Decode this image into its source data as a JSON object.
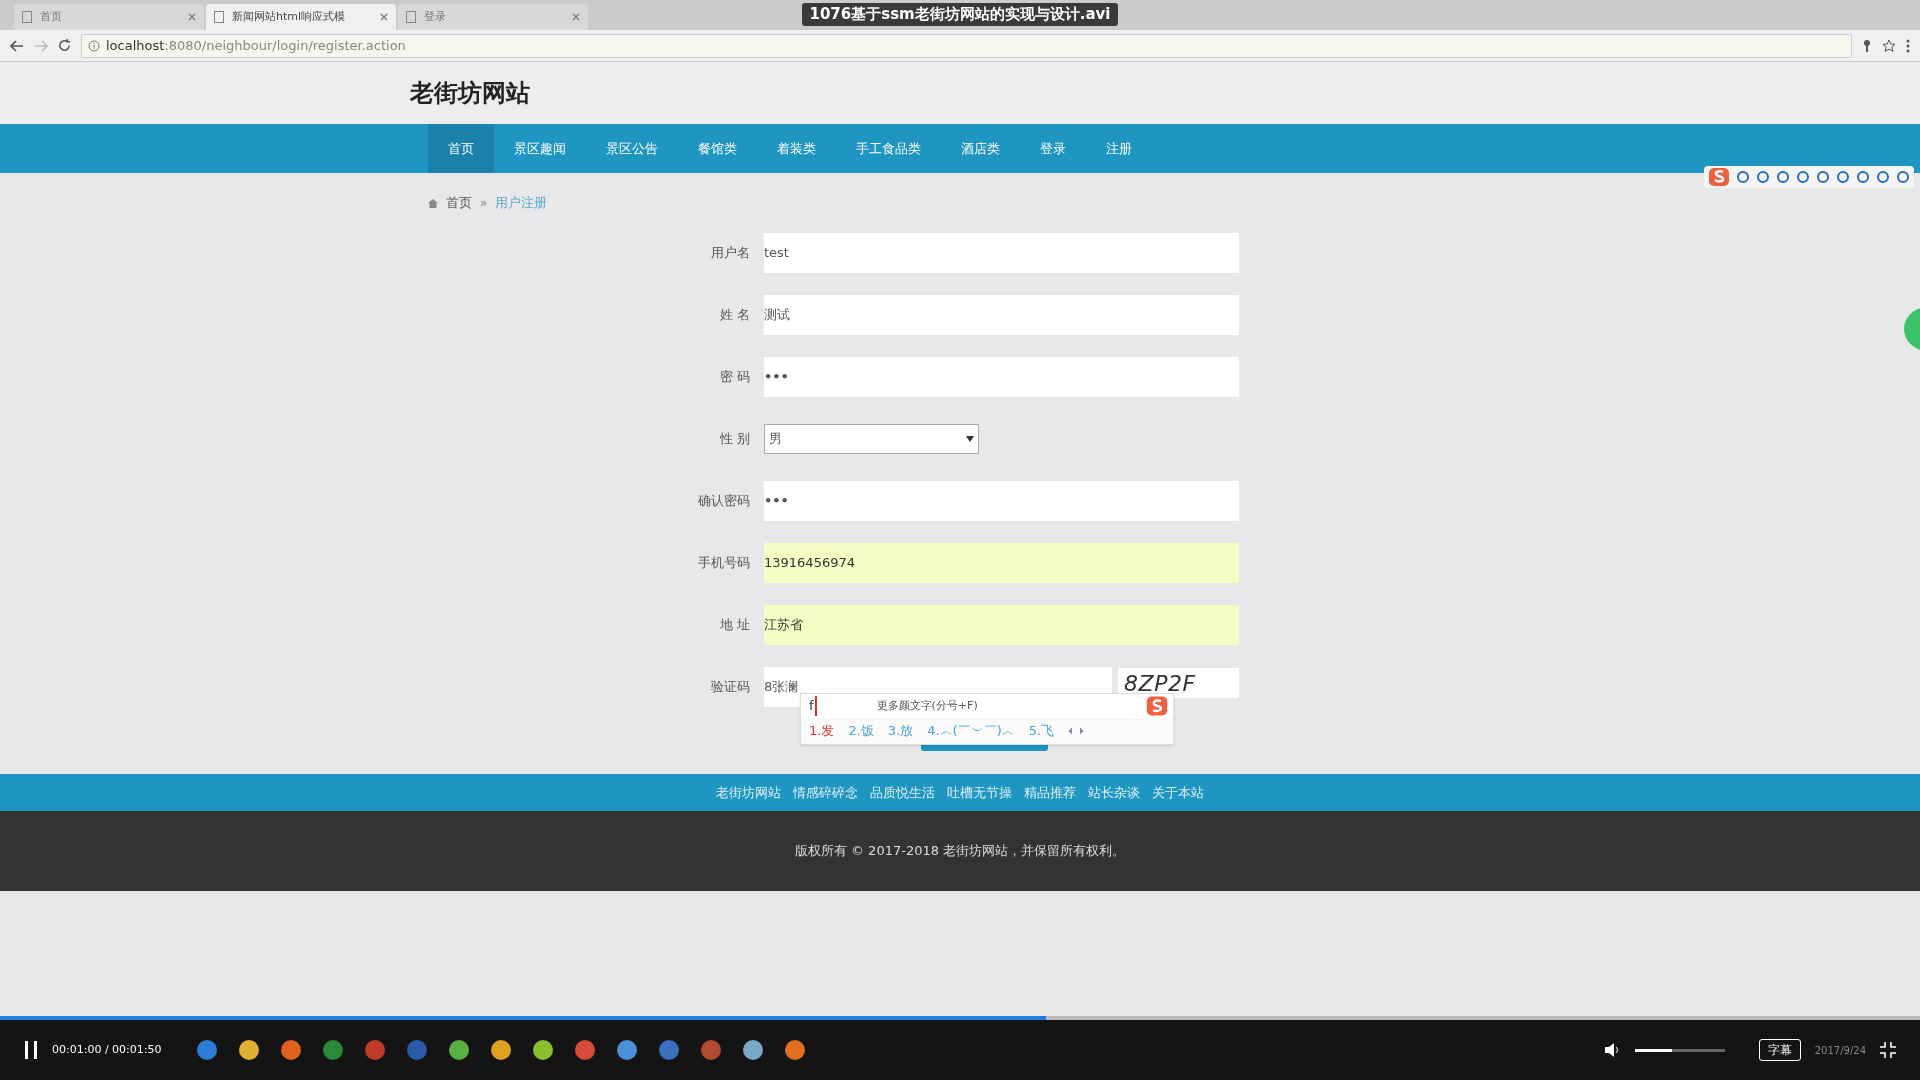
{
  "browser": {
    "tabs": [
      {
        "label": "首页",
        "selected": false
      },
      {
        "label": "新闻网站html响应式模",
        "selected": true
      },
      {
        "label": "登录",
        "selected": false
      }
    ],
    "url_host": "localhost",
    "url_path": ":8080/neighbour/login/register.action"
  },
  "video_title": "1076基于ssm老街坊网站的实现与设计.avi",
  "site": {
    "title": "老街坊网站",
    "nav": [
      {
        "label": "首页",
        "selected": true
      },
      {
        "label": "景区趣闻",
        "selected": false
      },
      {
        "label": "景区公告",
        "selected": false
      },
      {
        "label": "餐馆类",
        "selected": false
      },
      {
        "label": "着装类",
        "selected": false
      },
      {
        "label": "手工食品类",
        "selected": false
      },
      {
        "label": "酒店类",
        "selected": false
      },
      {
        "label": "登录",
        "selected": false
      },
      {
        "label": "注册",
        "selected": false
      }
    ],
    "breadcrumb": {
      "items": [
        "首页",
        "用户注册"
      ],
      "separator": "»"
    }
  },
  "form": {
    "fields": [
      {
        "label": "用户名",
        "kind": "text",
        "value": "test",
        "autofilled": false
      },
      {
        "label": "姓 名",
        "kind": "text",
        "value": "测试",
        "autofilled": false
      },
      {
        "label": "密 码",
        "kind": "password",
        "value": "•••",
        "autofilled": false
      },
      {
        "label": "性 别",
        "kind": "select",
        "value": "男",
        "autofilled": false
      },
      {
        "label": "确认密码",
        "kind": "password",
        "value": "•••",
        "autofilled": false
      },
      {
        "label": "手机号码",
        "kind": "text",
        "value": "13916456974",
        "autofilled": true
      },
      {
        "label": "地 址",
        "kind": "text",
        "value": "江苏省",
        "autofilled": true
      },
      {
        "label": "验证码",
        "kind": "captcha",
        "value": "8张澜",
        "captcha": "8ZP2F",
        "autofilled": false
      }
    ]
  },
  "ime": {
    "input": "f",
    "hint": "更多颜文字(分号+F)",
    "candidates": [
      {
        "label": "1.发",
        "selected": true
      },
      {
        "label": "2.饭",
        "selected": false
      },
      {
        "label": "3.放",
        "selected": false
      },
      {
        "label": "4.︿(￣︶￣)︿",
        "selected": false
      },
      {
        "label": "5.飞",
        "selected": false
      }
    ]
  },
  "footer": {
    "links": [
      "老街坊网站",
      "情感碎碎念",
      "品质悦生活",
      "吐槽无节操",
      "精品推荐",
      "站长杂谈",
      "关于本站"
    ],
    "copyright": "版权所有 © 2017-2018 老街坊网站，并保留所有权利。"
  },
  "player": {
    "time": "00:01:00 / 00:01:50",
    "progress": {
      "level": 0.545
    },
    "volume": {
      "level": 0.41
    },
    "subtitle_button": "字幕",
    "date": "2017/9/24"
  }
}
